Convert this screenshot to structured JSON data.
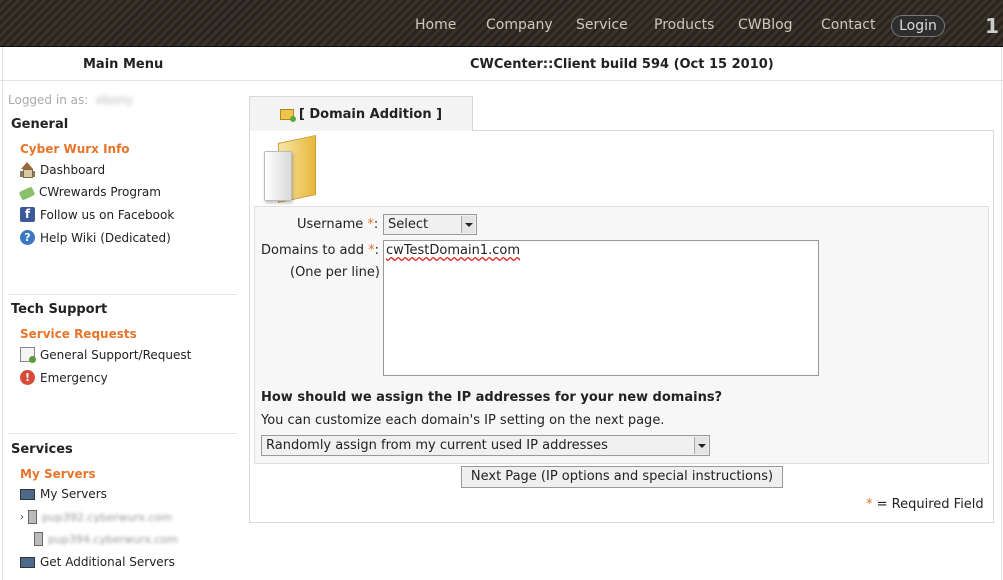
{
  "topnav": {
    "items": [
      "Home",
      "Company",
      "Service",
      "Products",
      "CWBlog",
      "Contact"
    ],
    "login": "Login",
    "page_number": "1"
  },
  "header": {
    "main_menu": "Main Menu",
    "build": "CWCenter::Client build 594 (Oct 15 2010)"
  },
  "sidebar": {
    "logged_in_label": "Logged in as:",
    "logged_in_user": "ebony",
    "general": {
      "title": "General",
      "sub": "Cyber Wurx Info",
      "items": [
        "Dashboard",
        "CWrewards Program",
        "Follow us on Facebook",
        "Help Wiki (Dedicated)"
      ]
    },
    "tech_support": {
      "title": "Tech Support",
      "sub": "Service Requests",
      "items": [
        "General Support/Request",
        "Emergency"
      ]
    },
    "services": {
      "title": "Services",
      "sub": "My Servers",
      "items": [
        "My Servers",
        "pup392.cyberwurx.com",
        "pup394.cyberwurx.com",
        "Get Additional Servers"
      ]
    }
  },
  "main": {
    "tab_label": "[ Domain Addition ]",
    "form": {
      "username_label": "Username",
      "username_value": "Select",
      "domains_label": "Domains to add",
      "domains_sub": "(One per line)",
      "domains_value": "cwTestDomain1.com",
      "required_mark": "*",
      "ip_question": "How should we assign the IP addresses for your new domains?",
      "ip_hint": "You can customize each domain's IP setting on the next page.",
      "ip_select_value": "Randomly assign from my current used IP addresses",
      "next_button": "Next Page (IP options and special instructions)",
      "required_note": "= Required Field"
    }
  },
  "colors": {
    "accent_orange": "#e8742a",
    "nav_bg": "#2e2822"
  }
}
